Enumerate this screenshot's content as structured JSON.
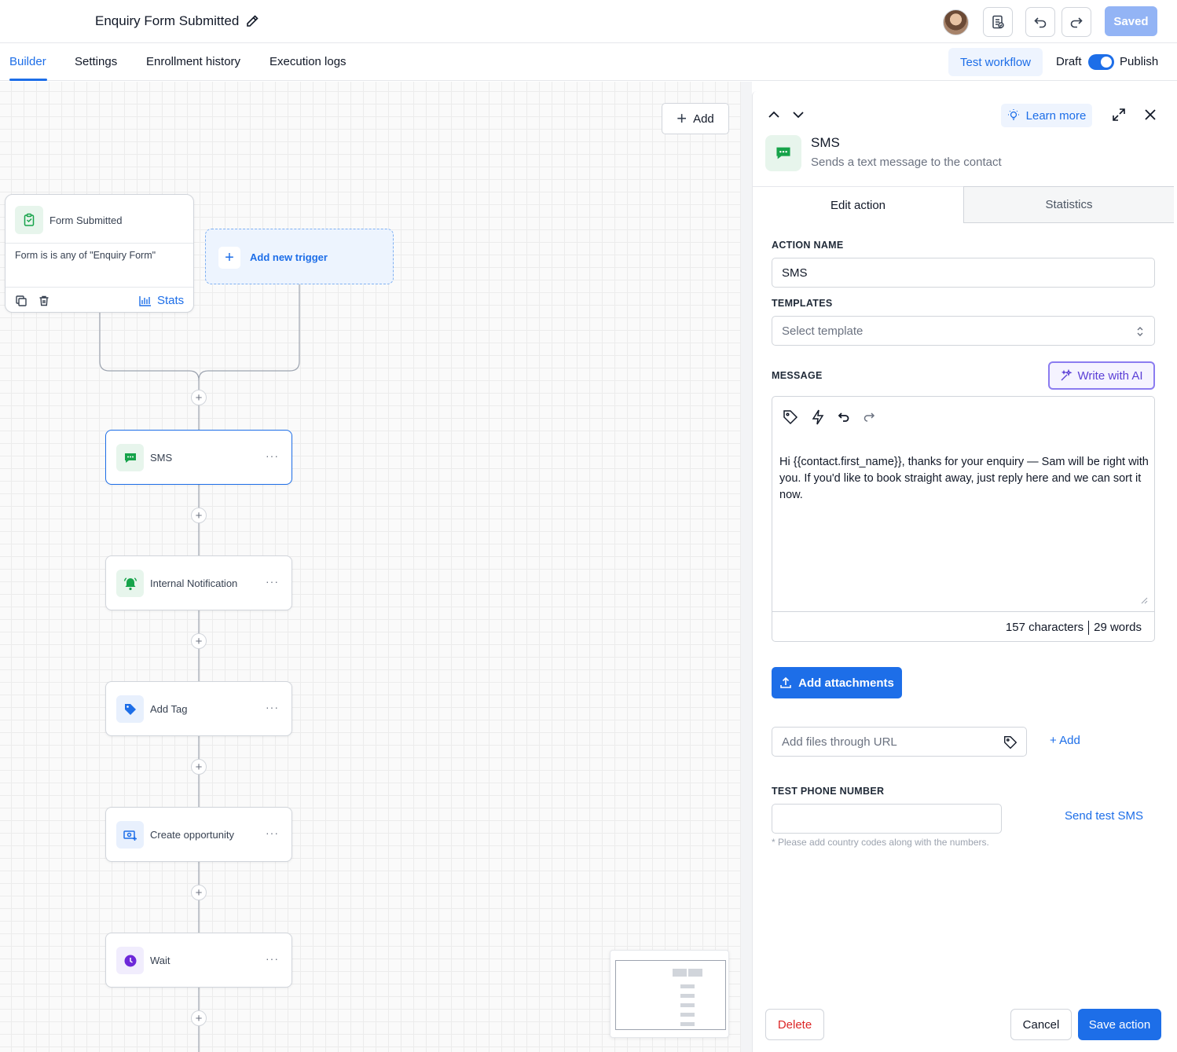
{
  "header": {
    "workflow_title": "Enquiry Form Submitted",
    "saved_label": "Saved",
    "icons": [
      "pencil-icon",
      "avatar",
      "document-check-icon",
      "undo-icon",
      "redo-icon"
    ]
  },
  "nav": {
    "tabs": [
      {
        "label": "Builder",
        "active": true
      },
      {
        "label": "Settings",
        "active": false
      },
      {
        "label": "Enrollment history",
        "active": false
      },
      {
        "label": "Execution logs",
        "active": false
      }
    ],
    "test_workflow": "Test workflow",
    "draft_label": "Draft",
    "publish_label": "Publish",
    "publish_toggle_on": true
  },
  "canvas": {
    "add_label": "Add",
    "trigger": {
      "title": "Form Submitted",
      "description": "Form is is any of \"Enquiry Form\"",
      "stats_label": "Stats"
    },
    "new_trigger_label": "Add new trigger",
    "nodes": [
      {
        "label": "SMS",
        "icon": "message-icon",
        "color": "#16a34a",
        "selected": true
      },
      {
        "label": "Internal Notification",
        "icon": "bell-icon",
        "color": "#16a34a",
        "selected": false
      },
      {
        "label": "Add Tag",
        "icon": "tag-icon",
        "color": "#1d6ee8",
        "selected": false
      },
      {
        "label": "Create opportunity",
        "icon": "opportunity-icon",
        "color": "#1d6ee8",
        "selected": false
      },
      {
        "label": "Wait",
        "icon": "clock-icon",
        "color": "#6d28d9",
        "selected": false
      }
    ],
    "node_menu": "···"
  },
  "panel": {
    "learn_more": "Learn more",
    "title": "SMS",
    "subtitle": "Sends a text message to the contact",
    "tabs": {
      "edit": "Edit action",
      "statistics": "Statistics"
    },
    "action_name_label": "ACTION NAME",
    "action_name_value": "SMS",
    "templates_label": "TEMPLATES",
    "templates_placeholder": "Select template",
    "message_label": "MESSAGE",
    "write_ai_label": "Write with AI",
    "message_text": "Hi {{contact.first_name}}, thanks for your enquiry — Sam will be right with you. If you'd like to book straight away, just reply here and we can sort it now.",
    "char_count": "157 characters",
    "word_count": "29 words",
    "add_attachments": "Add attachments",
    "url_placeholder": "Add files through URL",
    "add_link": "+ Add",
    "test_phone_label": "TEST PHONE NUMBER",
    "test_phone_hint": "* Please add country codes along with the numbers.",
    "send_test": "Send test SMS",
    "delete": "Delete",
    "cancel": "Cancel",
    "save": "Save action"
  }
}
